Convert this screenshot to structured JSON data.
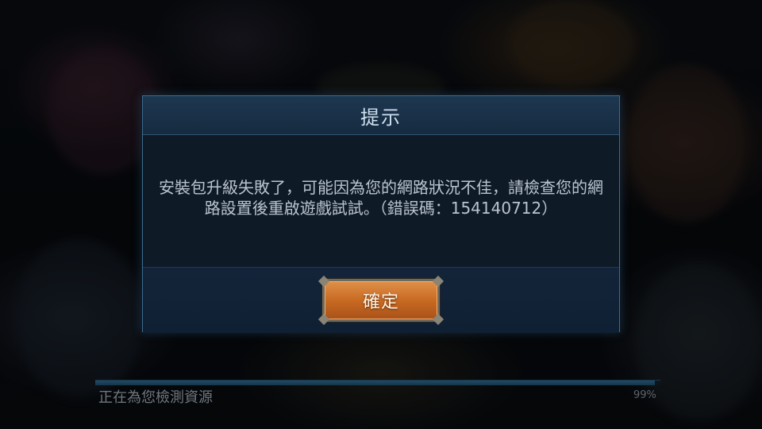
{
  "dialog": {
    "title": "提示",
    "message": "安裝包升級失敗了，可能因為您的網路狀況不佳，請檢查您的網路設置後重啟遊戲試試。（錯誤碼：154140712）",
    "confirm_label": "確定"
  },
  "loading": {
    "status_text": "正在為您檢測資源",
    "percent_text": "99%",
    "progress": 0.99
  },
  "colors": {
    "dialog_border": "#3e6b8e",
    "button_orange": "#c86a22"
  }
}
